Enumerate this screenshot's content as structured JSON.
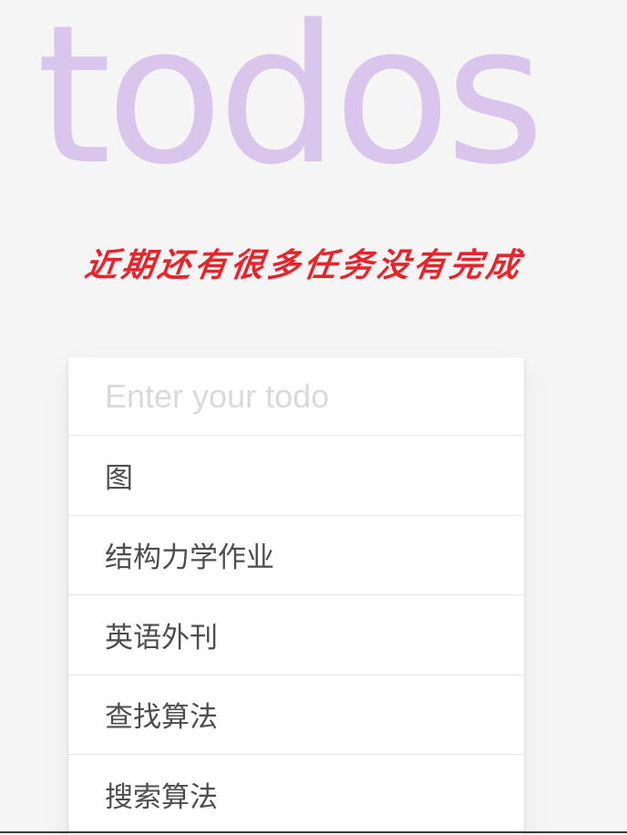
{
  "app": {
    "title": "todos",
    "subtitle": "近期还有很多任务没有完成"
  },
  "new_todo": {
    "placeholder": "Enter your todo",
    "value": ""
  },
  "todos": [
    {
      "label": "图"
    },
    {
      "label": "结构力学作业"
    },
    {
      "label": "英语外刊"
    },
    {
      "label": "查找算法"
    },
    {
      "label": "搜索算法"
    }
  ],
  "colors": {
    "background": "#f5f5f5",
    "title": "#dac6ec",
    "subtitle": "#e8232a",
    "panel": "#ffffff",
    "item_text": "#4d4d4d",
    "placeholder": "#d9d9d9"
  }
}
